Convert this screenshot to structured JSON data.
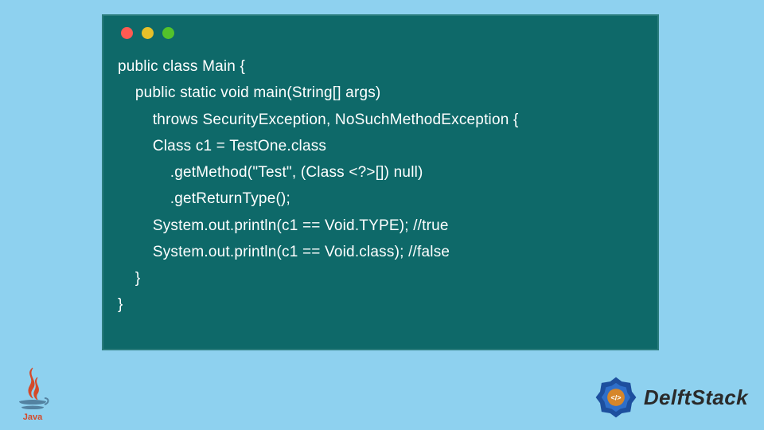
{
  "code": {
    "line1": "public class Main {",
    "line2": "    public static void main(String[] args)",
    "line3": "        throws SecurityException, NoSuchMethodException {",
    "line4": "        Class c1 = TestOne.class",
    "line5": "            .getMethod(\"Test\", (Class <?>[]) null)",
    "line6": "            .getReturnType();",
    "line7": "        System.out.println(c1 == Void.TYPE); //true",
    "line8": "        System.out.println(c1 == Void.class); //false",
    "line9": "    }",
    "line10": "}"
  },
  "branding": {
    "delftstack": "DelftStack",
    "java": "Java"
  },
  "colors": {
    "page_bg": "#8ed1ef",
    "panel_bg": "#0e6969",
    "code_fg": "#ffffff",
    "dot_red": "#ff5a52",
    "dot_yellow": "#e6c029",
    "dot_green": "#53c22b"
  }
}
